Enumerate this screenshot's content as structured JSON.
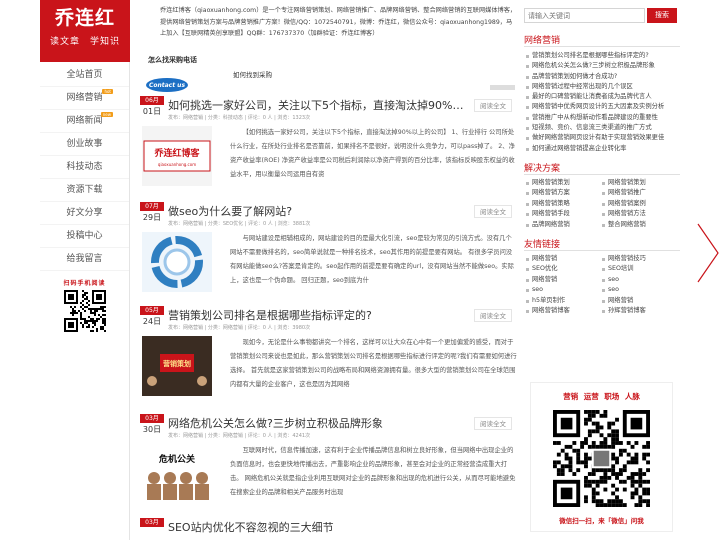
{
  "site": {
    "name": "乔连红",
    "slogan": "读文章　学知识"
  },
  "nav": [
    {
      "label": "全站首页",
      "badge": ""
    },
    {
      "label": "网络营销",
      "badge": "hot"
    },
    {
      "label": "网络新闻",
      "badge": "new"
    },
    {
      "label": "创业故事",
      "badge": ""
    },
    {
      "label": "科技动态",
      "badge": ""
    },
    {
      "label": "资源下载",
      "badge": ""
    },
    {
      "label": "好文分享",
      "badge": ""
    },
    {
      "label": "投稿中心",
      "badge": ""
    },
    {
      "label": "给我留言",
      "badge": ""
    }
  ],
  "left_scan_label": "扫码手机阅读",
  "intro": "乔连红博客（qiaoxuanhong.com）是一个专注网络营销策划、网络营销推广、品牌网络营销、整合网络营销的互联网媒体博客，提供网络营销策划方案与品牌营销推广方案！微信/QQ：1072540791，微博：乔连红，微信公众号：qiaoxuanhong1989，马上加入【互联网精英创享联盟】QQ群：176737370（加群验证：乔连红博客）",
  "contact": {
    "title": "怎么找采购电话",
    "link": "如何找到采购",
    "badge": "Contact us"
  },
  "read_full_label": "阅读全文",
  "articles": [
    {
      "month": "06月",
      "day": "01日",
      "title": "如何挑选一家好公司，关注以下5个指标，直接淘汰掉90%以上...",
      "meta": "发布：网络营销 | 分类：科技动态 | 评论：0 人 | 浏览：1323次",
      "excerpt": "【如何挑选一家好公司，关注以下5个指标，直接淘汰掉90%以上的公司】 1、行业排行 公司所处什么行业，在所处行业排名是否靠前，如果排名不是很好，说明没什么竞争力，可以pass掉了。 2、净资产收益率(ROE) 净资产收益率是公司税后利润除以净资产得到的百分比率，该指标反映股东权益的收益水平，用以衡量公司运用自有资",
      "thumb": "乔连红博客",
      "thumb_sub": "qiaoxuanhong.com"
    },
    {
      "month": "07月",
      "day": "29日",
      "title": "做seo为什么要了解网站?",
      "meta": "发布：网络营销 | 分类：SEO优化 | 评论：0 人 | 浏览：3881次",
      "excerpt": "与网站建设是相辅相成的，网站建设的目的是最大化引流，seo是较为常见的引流方式。没有几个网站不需要做排名的，seo简单说就是一种排名技术，seo其作用的前提是要有网站。 有很多学员问没有网站能做seo么?答案是肯定的。seo起作用的前提是要有确定的url，没有网站当然不能做seo。实际上，这也是一个伪命题。 回归正题，seo到底为什",
      "thumb": ""
    },
    {
      "month": "05月",
      "day": "24日",
      "title": "营销策划公司排名是根据哪些指标评定的?",
      "meta": "发布：网络营销 | 分类：网络营销 | 评论：0 人 | 浏览：3980次",
      "excerpt": "现如今，无论是什么事物都讲究一个排名，这样可以让大众在心中有一个更加偏爱的感受，而对于营销策划公司来说也是如此，那么营销策划公司排名是根据哪些指标进行评定的呢?我们有需要如何进行选择。 首先就是这家营销策划公司的战略布局和网络资源拥有量。很多大型的营销策划公司在全球范围内都有大量的企业客户，这也是因为其网络",
      "thumb": "营销策划"
    },
    {
      "month": "03月",
      "day": "30日",
      "title": "网络危机公关怎么做?三步树立积极品牌形象",
      "meta": "发布：网络营销 | 分类：网络营销 | 评论：0 人 | 浏览：4241次",
      "excerpt": "互联网时代，信息传播加速，这有利于企业传播品牌信息和树立良好形象，但当网络中出现企业的负面信息时，也会更快地传播出去，严重影响企业的品牌形象，甚至会对企业的正常经营造成重大打击。 网络危机公关就是指企业利用互联网对企业的品牌形象和出现的危机进行公关，从而尽可能地避免在搜索企业的品牌和相关产品服务时出现",
      "thumb": "危机公关"
    },
    {
      "month": "03月",
      "day": "",
      "title": "SEO站内优化不容忽视的三大细节",
      "meta": "",
      "excerpt": "",
      "thumb": ""
    }
  ],
  "search": {
    "placeholder": "请输入关键词",
    "button": "搜索"
  },
  "sections": {
    "network_marketing": {
      "title": "网络营销",
      "items": [
        "营销策划公司排名是根据哪些指标评定的?",
        "网络危机公关怎么做?三步树立积极品牌形象",
        "品牌营销策划如何做才合成功?",
        "网络营销过程中经常出现的几个误区",
        "最好的口碑营销能让消费者成为品牌代言人",
        "网络营销中优秀网页设计的五大因素及实例分析",
        "营销推广中从构想新动作看品牌建设的重要性",
        "短视频、竞价、信息流三类渠道的推广方式",
        "做好网络营销网页设计有助于实现营销效果更佳",
        "如何通过网络营销提高企业转化率"
      ]
    },
    "solutions": {
      "title": "解决方案",
      "items": [
        "网络营销策划",
        "网络营销策划",
        "网络营销方案",
        "网络营销推广",
        "网络营销策略",
        "网络营销案例",
        "网络营销手段",
        "网络营销方法",
        "品牌网络营销",
        "整合网络营销"
      ]
    },
    "friend_links": {
      "title": "友情链接",
      "items": [
        "网络营销",
        "网络营销技巧",
        "SEO优化",
        "SEO培训",
        "网络营销",
        "seo",
        "seo",
        "seo",
        "h5单页制作",
        "网络营销",
        "网络营销博客",
        "孙辉营销博客"
      ]
    }
  },
  "qr_card": {
    "top": "营销 运营 职场 人脉",
    "bottom": "微信扫一扫，来「微信」问我"
  },
  "colors": {
    "brand_red": "#c9141a",
    "badge_orange": "#f29d1a"
  }
}
